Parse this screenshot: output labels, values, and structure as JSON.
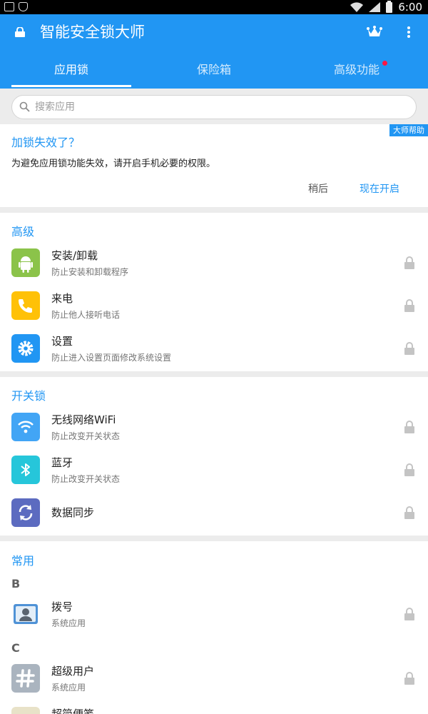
{
  "status_bar": {
    "time": "6:00"
  },
  "app": {
    "title": "智能安全锁大师"
  },
  "tabs": [
    {
      "label": "应用锁"
    },
    {
      "label": "保险箱"
    },
    {
      "label": "高级功能"
    }
  ],
  "search": {
    "placeholder": "搜索应用"
  },
  "warning": {
    "badge": "大师帮助",
    "title": "加锁失效了？",
    "text": "为避免应用锁功能失效，请开启手机必要的权限。",
    "later_label": "稍后",
    "enable_label": "现在开启"
  },
  "sections": {
    "advanced": {
      "title": "高级",
      "items": [
        {
          "title": "安装/卸载",
          "subtitle": "防止安装和卸载程序",
          "icon": "android-icon",
          "color": "#8bc34a"
        },
        {
          "title": "来电",
          "subtitle": "防止他人接听电话",
          "icon": "phone-icon",
          "color": "#ffc107"
        },
        {
          "title": "设置",
          "subtitle": "防止进入设置页面修改系统设置",
          "icon": "gear-icon",
          "color": "#2196f3"
        }
      ]
    },
    "switch_lock": {
      "title": "开关锁",
      "items": [
        {
          "title": "无线网络WiFi",
          "subtitle": "防止改变开关状态",
          "icon": "wifi-icon",
          "color": "#42a5f5"
        },
        {
          "title": "蓝牙",
          "subtitle": "防止改变开关状态",
          "icon": "bluetooth-icon",
          "color": "#26c6da"
        },
        {
          "title": "数据同步",
          "subtitle": "",
          "icon": "sync-icon",
          "color": "#5c6bc0"
        }
      ]
    },
    "common": {
      "title": "常用",
      "groups": [
        {
          "letter": "B",
          "items": [
            {
              "title": "拨号",
              "subtitle": "系统应用",
              "icon": "contacts-app-icon"
            }
          ]
        },
        {
          "letter": "C",
          "items": [
            {
              "title": "超级用户",
              "subtitle": "系统应用",
              "icon": "superuser-app-icon"
            },
            {
              "title": "超简便笺",
              "subtitle": "",
              "icon": "notes-app-icon"
            }
          ]
        }
      ]
    }
  }
}
